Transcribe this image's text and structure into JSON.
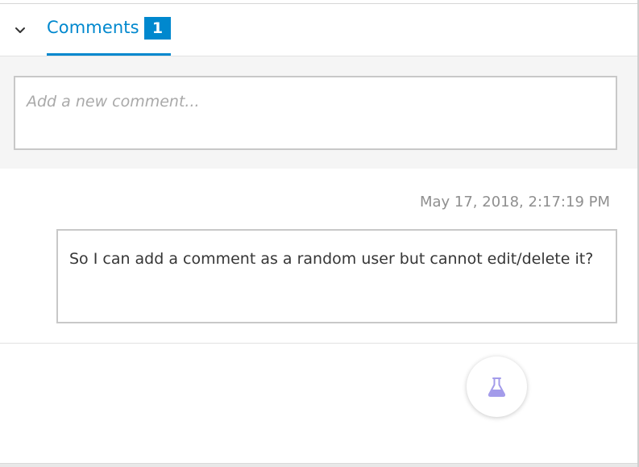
{
  "comments_tab": {
    "label": "Comments",
    "count": "1"
  },
  "composer": {
    "placeholder": "Add a new comment...",
    "value": ""
  },
  "comments": [
    {
      "timestamp": "May 17, 2018, 2:17:19 PM",
      "text": "So I can add a comment as a random user but cannot edit/delete it?"
    }
  ],
  "icons": {
    "collapse": "chevron-down-icon",
    "fab": "flask-icon"
  },
  "colors": {
    "accent": "#0088ce",
    "fab_icon": "#a39bea"
  }
}
